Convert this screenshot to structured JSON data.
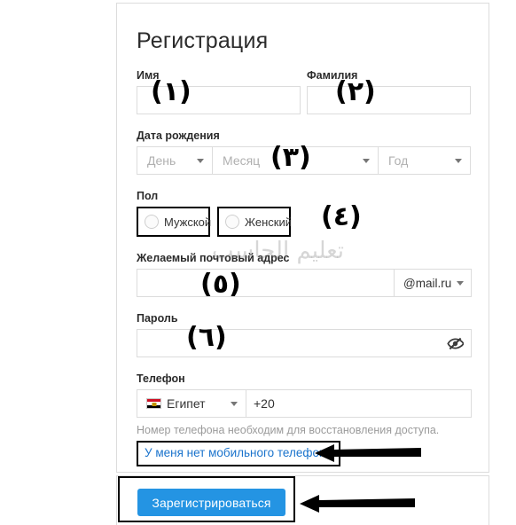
{
  "form": {
    "title": "Регистрация",
    "labels": {
      "first_name": "Имя",
      "last_name": "Фамилия",
      "birth_date": "Дата рождения",
      "gender": "Пол",
      "email": "Желаемый почтовый адрес",
      "password": "Пароль",
      "phone": "Телефон"
    },
    "first_name_value": "",
    "last_name_value": "",
    "birth_date": {
      "day_placeholder": "День",
      "month_placeholder": "Месяц",
      "year_placeholder": "Год"
    },
    "gender_options": [
      {
        "label": "Мужской",
        "selected": false
      },
      {
        "label": "Женский",
        "selected": false
      }
    ],
    "email_value": "",
    "email_domain": "@mail.ru",
    "password_value": "",
    "password_toggle_icon": "eye-off-icon",
    "phone": {
      "country": "Египет",
      "country_flag": "flag-egypt-icon",
      "code": "+20"
    },
    "hint": "Номер телефона необходим для восстановления доступа.",
    "no_phone_link": "У меня нет мобильного телефона",
    "submit_label": "Зарегистрироваться"
  },
  "annotations": {
    "numbers": [
      {
        "glyph": "(١)",
        "step": 1,
        "target": "first-name-field"
      },
      {
        "glyph": "(٢)",
        "step": 2,
        "target": "last-name-field"
      },
      {
        "glyph": "(٣)",
        "step": 3,
        "target": "birth-date-row"
      },
      {
        "glyph": "(٤)",
        "step": 4,
        "target": "gender-row"
      },
      {
        "glyph": "(٥)",
        "step": 5,
        "target": "email-field"
      },
      {
        "glyph": "(٦)",
        "step": 6,
        "target": "password-field"
      }
    ],
    "arrows": [
      {
        "target": "no-phone-link",
        "direction": "left"
      },
      {
        "target": "submit-button",
        "direction": "left"
      }
    ],
    "watermark_text": "تعليم الحاسب"
  },
  "colors": {
    "accent_blue": "#2494e3",
    "link_blue": "#1a73cc",
    "border_gray": "#dcdcdc",
    "placeholder_gray": "#b0b0b0",
    "hint_gray": "#9b9b9b",
    "annotation_black": "#000000"
  }
}
